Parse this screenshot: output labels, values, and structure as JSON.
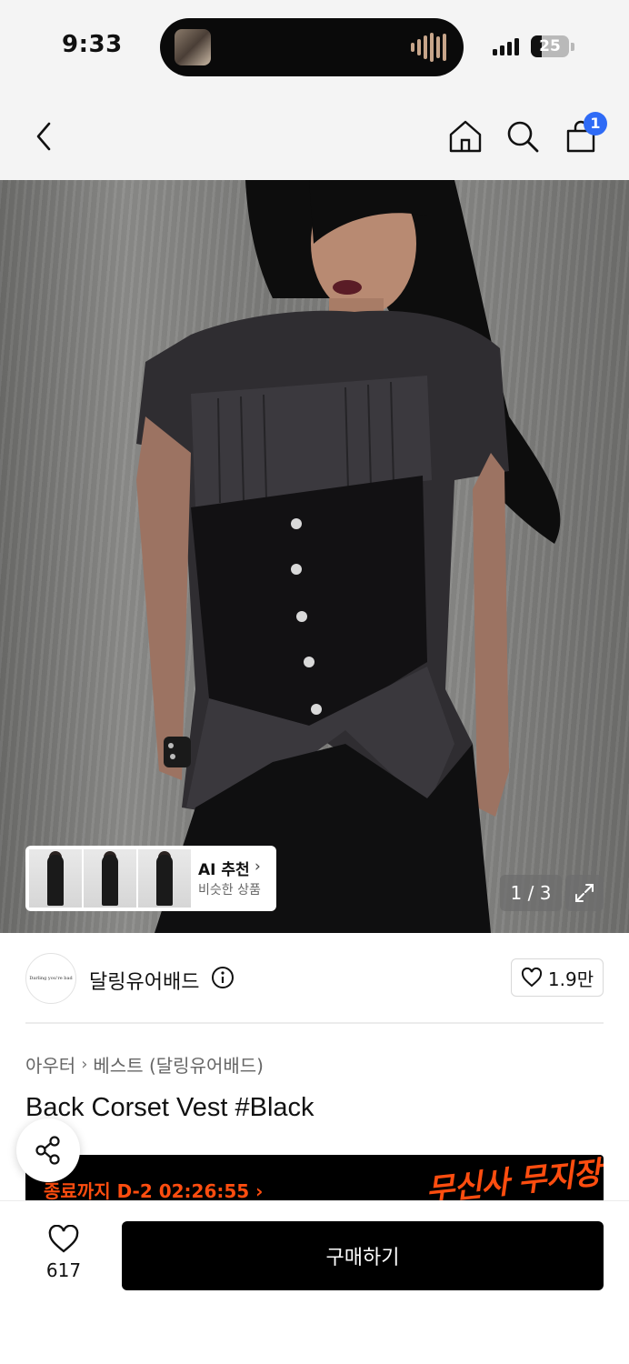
{
  "status_bar": {
    "time": "9:33",
    "battery": "25"
  },
  "nav": {
    "icons": [
      "back-icon",
      "home-icon",
      "search-icon",
      "cart-icon"
    ],
    "cart_count": "1"
  },
  "hero": {
    "ai_recommend_title": "AI 추천",
    "ai_recommend_sub": "비슷한 상품",
    "page_counter": "1 / 3"
  },
  "brand": {
    "logo_text": "Darling you're bad",
    "name": "달링유어배드",
    "likes": "1.9만"
  },
  "breadcrumb": {
    "category": "아우터",
    "subcategory": "베스트 (달링유어배드)"
  },
  "product": {
    "title": "Back Corset Vest #Black"
  },
  "promo": {
    "text": "종료까지 D-2 02:26:55 ›",
    "logo": "무신사 무지장"
  },
  "bottom_bar": {
    "wish_count": "617",
    "buy_label": "구매하기"
  },
  "colors": {
    "accent_blue": "#2f6bf6",
    "promo_orange": "#ff4d0f"
  }
}
